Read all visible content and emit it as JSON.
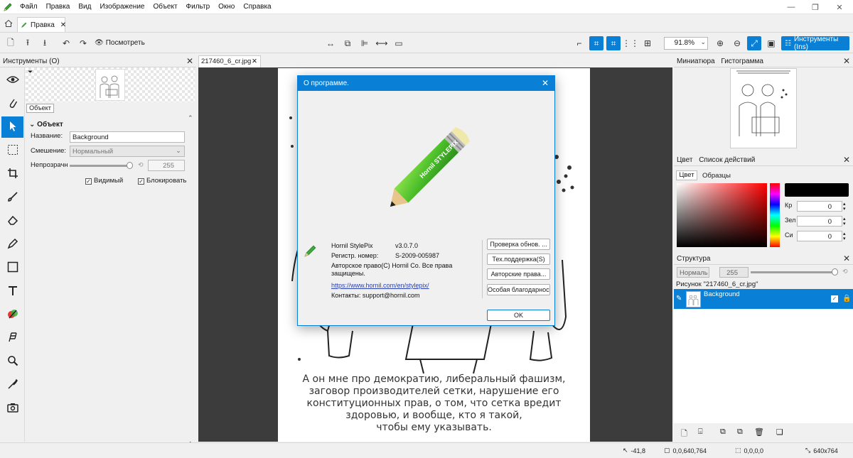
{
  "menubar": {
    "items": [
      "Файл",
      "Правка",
      "Вид",
      "Изображение",
      "Объект",
      "Фильтр",
      "Окно",
      "Справка"
    ]
  },
  "doc_tab": {
    "label": "Правка"
  },
  "toolbar": {
    "preview_label": "Посмотреть",
    "zoom_value": "91.8%",
    "tools_label": "Инструменты (Ins)"
  },
  "tools_panel": {
    "title": "Инструменты (O)",
    "object_button": "Объект",
    "section_title": "Объект",
    "name_label": "Название:",
    "name_value": "Background",
    "blend_label": "Смешение:",
    "blend_value": "Нормальный",
    "opacity_label": "Непрозрачн",
    "opacity_value": "255",
    "opacity_fraction": 1.0,
    "visible_label": "Видимый",
    "lock_label": "Блокировать"
  },
  "canvas": {
    "tab_label": "217460_6_cr.jpg",
    "caption_lines": [
      "А он мне про демократию, либеральный фашизм,",
      "заговор производителей сетки, нарушение его",
      "конституционных прав, о том, что сетка вредит",
      "здоровью, и вообще, кто я такой,",
      "чтобы ему указывать."
    ]
  },
  "dialog": {
    "title": "О программе.",
    "product_label": "Hornil StylePix",
    "version": "v3.0.7.0",
    "reg_label": "Регистр. номер:",
    "reg_value": "S-2009-005987",
    "copyright": "Авторское право(C) Hornil Co. Все права защищены.",
    "url": "https://www.hornil.com/en/stylepix/",
    "contacts": "Контакты: support@hornil.com",
    "buttons": {
      "check_updates": "Проверка обнов. ...",
      "support": "Тех.поддержка(S)",
      "copyrights": "Авторские права...",
      "thanks": "Особая благодарность",
      "ok": "OK"
    },
    "pencil_text": "Hornil STYLEPIX"
  },
  "right": {
    "tabs_top": [
      "Миниатюра",
      "Гистограмма"
    ],
    "tabs_color": [
      "Цвет",
      "Список действий"
    ],
    "color_subtabs": [
      "Цвет",
      "Образцы"
    ],
    "rgb": [
      {
        "label": "Кр",
        "value": "0"
      },
      {
        "label": "Зел",
        "value": "0"
      },
      {
        "label": "Си",
        "value": "0"
      }
    ],
    "structure_title": "Структура",
    "structure_blend": "Нормаль",
    "structure_opacity": "255",
    "image_label": "Рисунок \"217460_6_cr.jpg\"",
    "layer_name": "Background"
  },
  "status": {
    "cursor": "-41,8",
    "selection": "0,0,640,764",
    "size2": "0,0,0,0",
    "image_size": "640x764"
  },
  "colors": {
    "accent": "#0a7fd6",
    "fg_swatch": "#000000"
  }
}
